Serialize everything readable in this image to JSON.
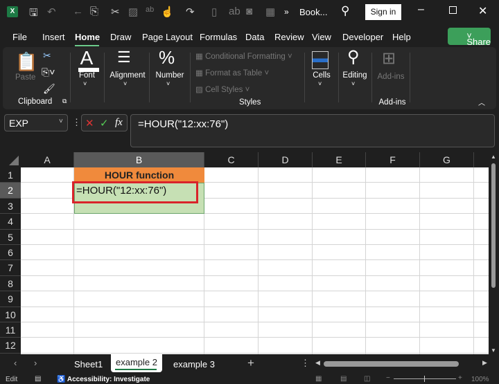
{
  "titlebar": {
    "doc_title": "Book...",
    "sign_in": "Sign in",
    "more": "»"
  },
  "menu": {
    "items": [
      "File",
      "Insert",
      "Home",
      "Draw",
      "Page Layout",
      "Formulas",
      "Data",
      "Review",
      "View",
      "Developer",
      "Help"
    ],
    "active": "Home",
    "share": "Share"
  },
  "ribbon": {
    "paste": "Paste",
    "clipboard": "Clipboard",
    "font": "Font",
    "alignment": "Alignment",
    "number": "Number",
    "conditional_formatting": "Conditional Formatting",
    "format_as_table": "Format as Table",
    "cell_styles": "Cell Styles",
    "styles": "Styles",
    "cells": "Cells",
    "editing": "Editing",
    "addins_button": "Add-ins",
    "addins_group": "Add-ins"
  },
  "formula_bar": {
    "name_box": "EXP",
    "fx": "fx",
    "formula": "=HOUR(\"12:xx:76\")"
  },
  "columns": [
    "A",
    "B",
    "C",
    "D",
    "E",
    "F",
    "G"
  ],
  "rows": [
    "1",
    "2",
    "3",
    "4",
    "5",
    "6",
    "7",
    "8",
    "9",
    "10",
    "11",
    "12"
  ],
  "cells": {
    "B1": "HOUR function",
    "B2": "=HOUR(\"12:xx:76\")"
  },
  "colors": {
    "header_fill": "#f08a3c",
    "data_fill": "#c6e0b4",
    "highlight_border": "#d9232a",
    "accent_green": "#3c9f5a"
  },
  "sheets": {
    "tabs": [
      "Sheet1",
      "example 2",
      "example 3"
    ],
    "active": "example 2",
    "add": "+"
  },
  "status": {
    "mode": "Edit",
    "accessibility": "Accessibility: Investigate",
    "zoom": "100%"
  }
}
